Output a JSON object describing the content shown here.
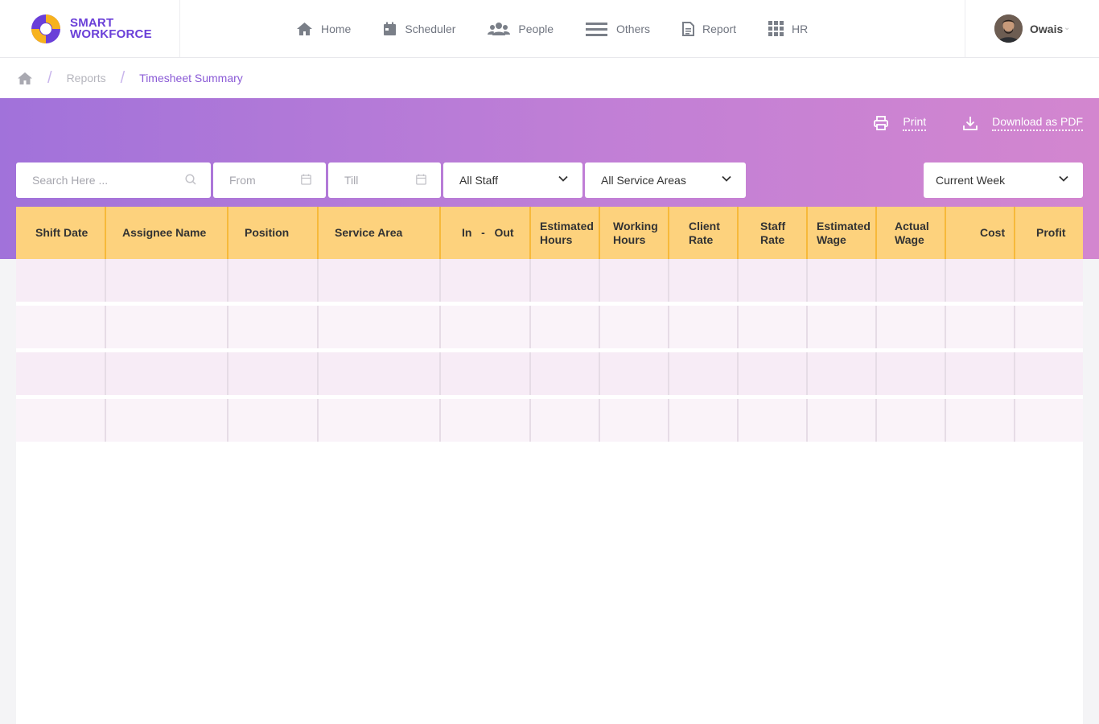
{
  "brand": {
    "line1": "SMART",
    "line2": "WORKFORCE"
  },
  "nav": [
    {
      "label": "Home",
      "icon": "home-icon"
    },
    {
      "label": "Scheduler",
      "icon": "calendar-icon"
    },
    {
      "label": "People",
      "icon": "people-icon"
    },
    {
      "label": "Others",
      "icon": "menu-icon"
    },
    {
      "label": "Report",
      "icon": "document-icon"
    },
    {
      "label": "HR",
      "icon": "grid-icon"
    }
  ],
  "user": {
    "name": "Owais"
  },
  "breadcrumb": {
    "reports": "Reports",
    "current": "Timesheet Summary"
  },
  "actions": {
    "print": "Print",
    "download": "Download as PDF"
  },
  "filters": {
    "search_placeholder": "Search Here ...",
    "from_placeholder": "From",
    "till_placeholder": "Till",
    "staff": "All Staff",
    "service_areas": "All Service Areas",
    "period": "Current Week"
  },
  "table": {
    "columns": [
      {
        "line1": "Shift Date",
        "line2": ""
      },
      {
        "line1": "Assignee Name",
        "line2": ""
      },
      {
        "line1": "Position",
        "line2": ""
      },
      {
        "line1": "Service Area",
        "line2": ""
      },
      {
        "line1": "In   -   Out",
        "line2": ""
      },
      {
        "line1": "Estimated",
        "line2": "Hours"
      },
      {
        "line1": "Working",
        "line2": "Hours"
      },
      {
        "line1": "Client",
        "line2": "Rate"
      },
      {
        "line1": "Staff",
        "line2": "Rate"
      },
      {
        "line1": "Estimated",
        "line2": "Wage"
      },
      {
        "line1": "Actual",
        "line2": "Wage"
      },
      {
        "line1": "Cost",
        "line2": ""
      },
      {
        "line1": "Profit",
        "line2": ""
      }
    ],
    "empty_rows": 4
  }
}
